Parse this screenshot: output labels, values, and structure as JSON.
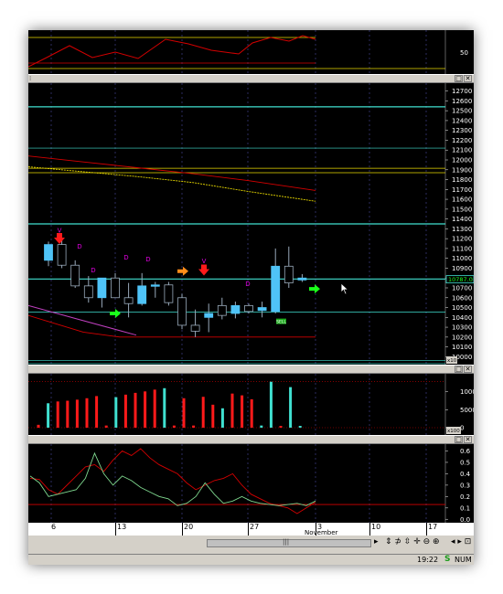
{
  "panels": {
    "osc_top": {
      "tick_label": "50",
      "tick_value": 50,
      "ylim": [
        0,
        100
      ],
      "level_line": 80
    },
    "price": {
      "ticks": [
        "12700",
        "12600",
        "12500",
        "12400",
        "12300",
        "12200",
        "12100",
        "12000",
        "11900",
        "11800",
        "11700",
        "11600",
        "11500",
        "11400",
        "11300",
        "11200",
        "11100",
        "11000",
        "10900",
        "10800",
        "10700",
        "10600",
        "10500",
        "10400",
        "10300",
        "10200",
        "10100",
        "10000"
      ],
      "ylim": [
        9920,
        12780
      ],
      "current_price": "10787.0",
      "scale_note": "x10",
      "hlines": [
        12540,
        12120,
        11915,
        11870,
        11350,
        10790,
        10455,
        9960,
        9930
      ],
      "candles": [
        {
          "o": 10980,
          "h": 11170,
          "l": 10920,
          "c": 11140
        },
        {
          "o": 11140,
          "h": 11200,
          "l": 10900,
          "c": 10930
        },
        {
          "o": 10930,
          "h": 10980,
          "l": 10700,
          "c": 10720
        },
        {
          "o": 10720,
          "h": 10820,
          "l": 10550,
          "c": 10600
        },
        {
          "o": 10600,
          "h": 10800,
          "l": 10500,
          "c": 10800
        },
        {
          "o": 10800,
          "h": 10850,
          "l": 10600,
          "c": 10600
        },
        {
          "o": 10600,
          "h": 10750,
          "l": 10400,
          "c": 10540
        },
        {
          "o": 10540,
          "h": 10850,
          "l": 10520,
          "c": 10720
        },
        {
          "o": 10720,
          "h": 10760,
          "l": 10600,
          "c": 10730
        },
        {
          "o": 10730,
          "h": 10760,
          "l": 10520,
          "c": 10550
        },
        {
          "o": 10600,
          "h": 10640,
          "l": 10280,
          "c": 10320
        },
        {
          "o": 10320,
          "h": 10480,
          "l": 10200,
          "c": 10260
        },
        {
          "o": 10400,
          "h": 10540,
          "l": 10250,
          "c": 10440
        },
        {
          "o": 10520,
          "h": 10600,
          "l": 10380,
          "c": 10420
        },
        {
          "o": 10440,
          "h": 10560,
          "l": 10390,
          "c": 10520
        },
        {
          "o": 10520,
          "h": 10540,
          "l": 10440,
          "c": 10460
        },
        {
          "o": 10470,
          "h": 10560,
          "l": 10400,
          "c": 10500
        },
        {
          "o": 10460,
          "h": 11100,
          "l": 10440,
          "c": 10920
        },
        {
          "o": 10920,
          "h": 11120,
          "l": 10700,
          "c": 10750
        },
        {
          "o": 10780,
          "h": 10840,
          "l": 10760,
          "c": 10800
        }
      ],
      "markers": {
        "letters": [
          "V",
          "D",
          "D",
          "D",
          "D",
          "V",
          "D"
        ],
        "signal_text": "SELL"
      }
    },
    "volume": {
      "ticks": [
        "10000",
        "5000",
        "0"
      ],
      "scale_note": "x100",
      "ylim": [
        0,
        14000
      ],
      "values": [
        800,
        6800,
        7300,
        7500,
        7800,
        8200,
        8800,
        600,
        8500,
        9200,
        9700,
        10100,
        10600,
        11000,
        600,
        8200,
        600,
        8600,
        6400,
        5400,
        9500,
        9000,
        7900,
        600,
        12800,
        500,
        11300,
        500
      ],
      "colors": [
        "r",
        "c",
        "r",
        "r",
        "r",
        "r",
        "r",
        "r",
        "c",
        "r",
        "r",
        "r",
        "r",
        "c",
        "r",
        "r",
        "r",
        "r",
        "r",
        "c",
        "r",
        "r",
        "r",
        "c",
        "c",
        "r",
        "c",
        "c"
      ]
    },
    "stoch": {
      "ticks": [
        "0.6",
        "0.5",
        "0.4",
        "0.3",
        "0.2",
        "0.1",
        "0.0"
      ],
      "ylim": [
        -0.03,
        0.66
      ],
      "level_line": 0.13,
      "k": [
        0.36,
        0.35,
        0.26,
        0.22,
        0.3,
        0.38,
        0.46,
        0.48,
        0.42,
        0.52,
        0.6,
        0.56,
        0.62,
        0.54,
        0.48,
        0.44,
        0.4,
        0.32,
        0.26,
        0.3,
        0.34,
        0.36,
        0.4,
        0.3,
        0.22,
        0.18,
        0.14,
        0.12,
        0.1,
        0.05,
        0.1,
        0.15
      ],
      "d": [
        0.38,
        0.32,
        0.2,
        0.22,
        0.24,
        0.26,
        0.36,
        0.58,
        0.4,
        0.3,
        0.38,
        0.34,
        0.28,
        0.24,
        0.2,
        0.18,
        0.12,
        0.14,
        0.2,
        0.32,
        0.22,
        0.14,
        0.16,
        0.2,
        0.16,
        0.14,
        0.13,
        0.12,
        0.13,
        0.14,
        0.12,
        0.16
      ]
    }
  },
  "time_axis": {
    "labels": [
      "6",
      "13",
      "20",
      "27",
      "3",
      "10",
      "17"
    ],
    "month": "November"
  },
  "titlebar_buttons": {
    "restore": "□",
    "close": "✕"
  },
  "status_bar": {
    "time": "19:22",
    "indicator": "S",
    "num_lock": "NUM"
  },
  "scroll_grip": "|||",
  "colors": {
    "bull": "#4fc3f7",
    "bear": "#ff1a1a",
    "hline": "#40e0d0",
    "ma_red": "#d40000",
    "ma_yellow": "#e8d800",
    "marker": "#e000e0",
    "grid": "#4a4aa0"
  }
}
